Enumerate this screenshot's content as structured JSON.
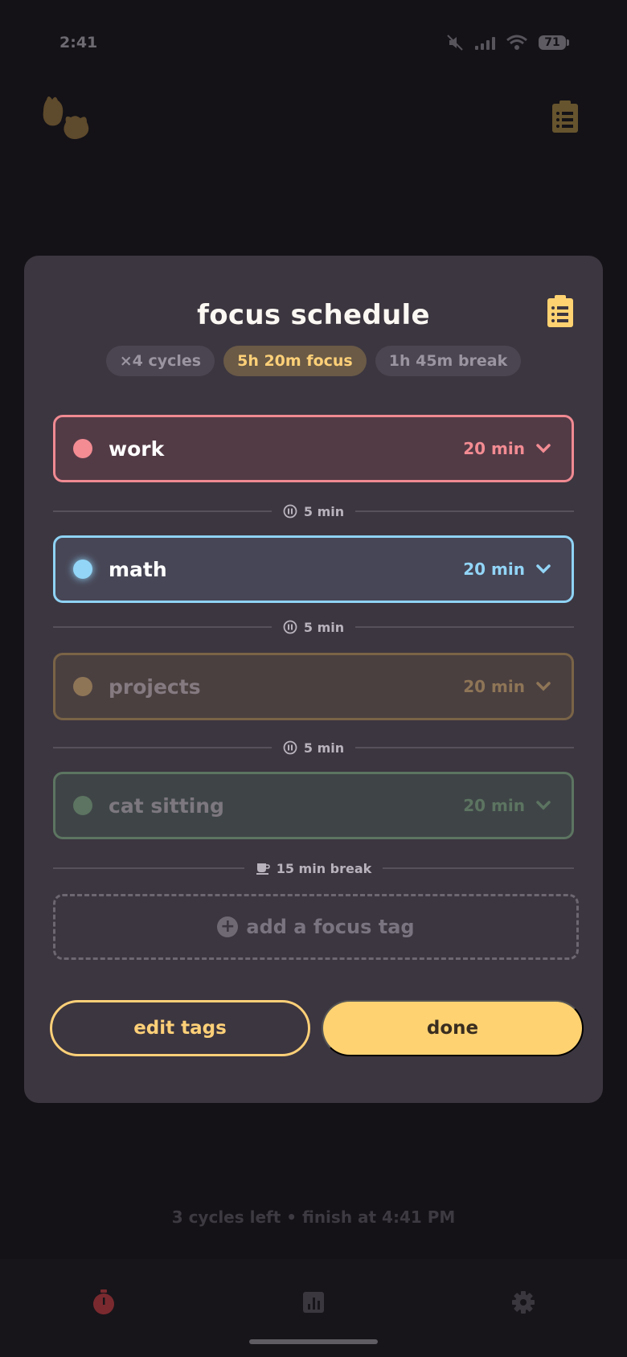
{
  "status_bar": {
    "time": "2:41",
    "battery": "71"
  },
  "header": {
    "logo": "bunny-cat-logo-icon",
    "schedule_icon": "clipboard-icon"
  },
  "modal": {
    "title": "focus schedule",
    "pills": {
      "cycles": "×4 cycles",
      "focus": "5h 20m focus",
      "break": "1h 45m break"
    },
    "tags": [
      {
        "name": "work",
        "duration": "20 min",
        "color": "#f38c93"
      },
      {
        "name": "math",
        "duration": "20 min",
        "color": "#92d5f7"
      },
      {
        "name": "projects",
        "duration": "20 min",
        "color": "#8e7556"
      },
      {
        "name": "cat sitting",
        "duration": "20 min",
        "color": "#5c7461"
      }
    ],
    "breaks": [
      {
        "label": "5 min",
        "icon": "pause-icon"
      },
      {
        "label": "5 min",
        "icon": "pause-icon"
      },
      {
        "label": "5 min",
        "icon": "pause-icon"
      },
      {
        "label": "15 min break",
        "icon": "coffee-cup-icon"
      }
    ],
    "add_tag_label": "add a focus tag",
    "edit_button": "edit tags",
    "done_button": "done"
  },
  "footer_info": "3 cycles left • finish at 4:41 PM",
  "tabbar": {
    "tabs": [
      "timer-icon",
      "stats-icon",
      "settings-icon"
    ]
  },
  "colors": {
    "accent": "#fed271",
    "background": "#141217",
    "modal": "#3c3640"
  }
}
